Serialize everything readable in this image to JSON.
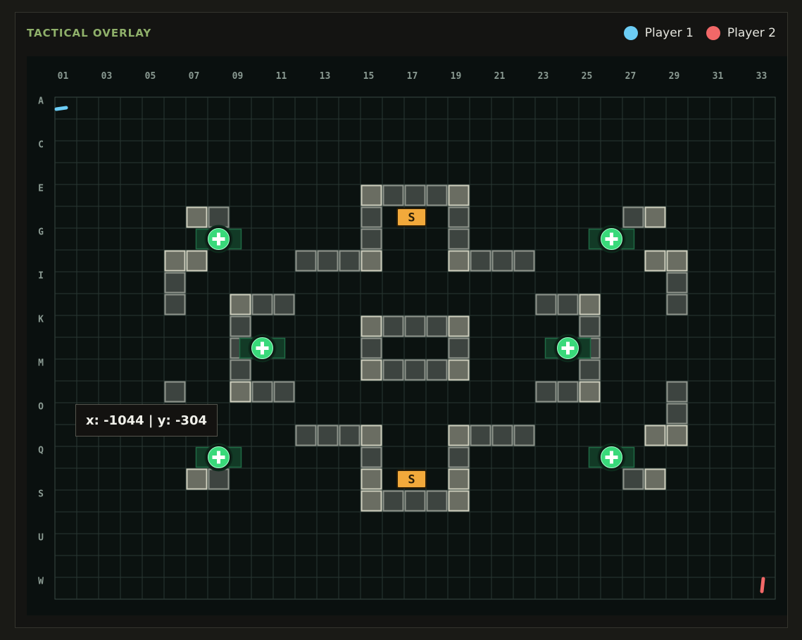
{
  "panel": {
    "title": "TACTICAL OVERLAY"
  },
  "legend": [
    {
      "label": "Player 1",
      "color": "#6ccdf5"
    },
    {
      "label": "Player 2",
      "color": "#f26868"
    }
  ],
  "grid": {
    "columns": 33,
    "rows": 23,
    "col_labels": [
      "01",
      "03",
      "05",
      "07",
      "09",
      "11",
      "13",
      "15",
      "17",
      "19",
      "21",
      "23",
      "25",
      "27",
      "29",
      "31",
      "33"
    ],
    "row_labels": [
      "A",
      "C",
      "E",
      "G",
      "I",
      "K",
      "M",
      "O",
      "Q",
      "S",
      "U",
      "W"
    ]
  },
  "walls": {
    "light": [
      [
        15,
        5
      ],
      [
        19,
        5
      ],
      [
        7,
        6
      ],
      [
        28,
        6
      ],
      [
        15,
        8
      ],
      [
        19,
        8
      ],
      [
        6,
        8
      ],
      [
        7,
        8
      ],
      [
        28,
        8
      ],
      [
        29,
        8
      ],
      [
        9,
        10
      ],
      [
        25,
        10
      ],
      [
        15,
        11
      ],
      [
        19,
        11
      ],
      [
        15,
        13
      ],
      [
        19,
        13
      ],
      [
        9,
        14
      ],
      [
        25,
        14
      ],
      [
        15,
        16
      ],
      [
        19,
        16
      ],
      [
        28,
        16
      ],
      [
        29,
        16
      ],
      [
        7,
        18
      ],
      [
        28,
        18
      ],
      [
        15,
        18
      ],
      [
        19,
        18
      ]
    ],
    "dark": [
      [
        16,
        5
      ],
      [
        17,
        5
      ],
      [
        18,
        5
      ],
      [
        8,
        6
      ],
      [
        27,
        6
      ],
      [
        15,
        6
      ],
      [
        19,
        6
      ],
      [
        15,
        7
      ],
      [
        19,
        7
      ],
      [
        12,
        8
      ],
      [
        13,
        8
      ],
      [
        14,
        8
      ],
      [
        20,
        8
      ],
      [
        21,
        8
      ],
      [
        22,
        8
      ],
      [
        6,
        9
      ],
      [
        29,
        9
      ],
      [
        6,
        10
      ],
      [
        29,
        10
      ],
      [
        10,
        10
      ],
      [
        11,
        10
      ],
      [
        23,
        10
      ],
      [
        24,
        10
      ],
      [
        9,
        11
      ],
      [
        25,
        11
      ],
      [
        9,
        12
      ],
      [
        25,
        12
      ],
      [
        9,
        13
      ],
      [
        25,
        13
      ],
      [
        16,
        11
      ],
      [
        17,
        11
      ],
      [
        18,
        11
      ],
      [
        15,
        12
      ],
      [
        19,
        12
      ],
      [
        16,
        13
      ],
      [
        17,
        13
      ],
      [
        18,
        13
      ],
      [
        10,
        14
      ],
      [
        11,
        14
      ],
      [
        23,
        14
      ],
      [
        24,
        14
      ],
      [
        6,
        14
      ],
      [
        29,
        14
      ],
      [
        29,
        15
      ],
      [
        12,
        16
      ],
      [
        13,
        16
      ],
      [
        14,
        16
      ],
      [
        20,
        16
      ],
      [
        21,
        16
      ],
      [
        22,
        16
      ],
      [
        15,
        17
      ],
      [
        19,
        17
      ],
      [
        15,
        18
      ],
      [
        19,
        18
      ],
      [
        16,
        19
      ],
      [
        17,
        19
      ],
      [
        18,
        19
      ],
      [
        8,
        18
      ],
      [
        27,
        18
      ]
    ],
    "light_bottom": [
      [
        15,
        19
      ],
      [
        19,
        19
      ],
      [
        7,
        18
      ],
      [
        28,
        18
      ]
    ]
  },
  "spawns": [
    {
      "label": "S",
      "col": 17,
      "row": 6
    },
    {
      "label": "S",
      "col": 17,
      "row": 18
    }
  ],
  "health_pickups": [
    {
      "col": 8,
      "row": 7
    },
    {
      "col": 26,
      "row": 7
    },
    {
      "col": 10,
      "row": 12
    },
    {
      "col": 24,
      "row": 12
    },
    {
      "col": 8,
      "row": 17
    },
    {
      "col": 26,
      "row": 17
    }
  ],
  "players": [
    {
      "name": "Player 1",
      "col": 1,
      "row": 1
    },
    {
      "name": "Player 2",
      "col": 33,
      "row": 23
    }
  ],
  "tooltip": {
    "text": "x: -1044 | y: -304"
  }
}
